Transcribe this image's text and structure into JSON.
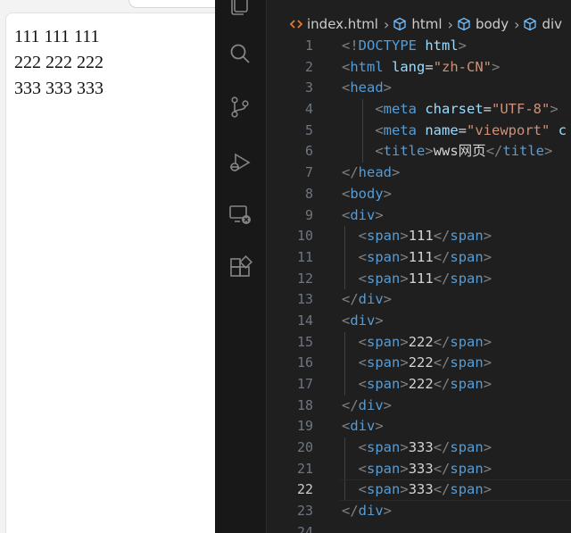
{
  "preview": {
    "rows": [
      [
        "111",
        "111",
        "111"
      ],
      [
        "222",
        "222",
        "222"
      ],
      [
        "333",
        "333",
        "333"
      ]
    ]
  },
  "editor": {
    "activity_icons": [
      "explorer-icon",
      "search-icon",
      "source-control-icon",
      "run-debug-icon",
      "remote-explorer-icon",
      "extensions-icon"
    ],
    "breadcrumb": {
      "file": "index.html",
      "items": [
        "html",
        "body",
        "div"
      ]
    },
    "active_line": 22,
    "line_numbers": [
      "1",
      "2",
      "3",
      "4",
      "5",
      "6",
      "7",
      "8",
      "9",
      "10",
      "11",
      "12",
      "13",
      "14",
      "15",
      "16",
      "17",
      "18",
      "19",
      "20",
      "21",
      "22",
      "23",
      "24"
    ],
    "lines": [
      [
        [
          "punct",
          "<!"
        ],
        [
          "tag",
          "DOCTYPE"
        ],
        [
          "text",
          " "
        ],
        [
          "attr",
          "html"
        ],
        [
          "punct",
          ">"
        ]
      ],
      [
        [
          "punct",
          "<"
        ],
        [
          "tag",
          "html"
        ],
        [
          "text",
          " "
        ],
        [
          "attr",
          "lang"
        ],
        [
          "text",
          "="
        ],
        [
          "str",
          "\"zh-CN\""
        ],
        [
          "punct",
          ">"
        ]
      ],
      [
        [
          "punct",
          "<"
        ],
        [
          "tag",
          "head"
        ],
        [
          "punct",
          ">"
        ]
      ],
      [
        [
          "text",
          "    "
        ],
        [
          "punct",
          "<"
        ],
        [
          "tag",
          "meta"
        ],
        [
          "text",
          " "
        ],
        [
          "attr",
          "charset"
        ],
        [
          "text",
          "="
        ],
        [
          "str",
          "\"UTF-8\""
        ],
        [
          "punct",
          ">"
        ]
      ],
      [
        [
          "text",
          "    "
        ],
        [
          "punct",
          "<"
        ],
        [
          "tag",
          "meta"
        ],
        [
          "text",
          " "
        ],
        [
          "attr",
          "name"
        ],
        [
          "text",
          "="
        ],
        [
          "str",
          "\"viewport\""
        ],
        [
          "text",
          " "
        ],
        [
          "attr",
          "c"
        ]
      ],
      [
        [
          "text",
          "    "
        ],
        [
          "punct",
          "<"
        ],
        [
          "tag",
          "title"
        ],
        [
          "punct",
          ">"
        ],
        [
          "text",
          "wws网页"
        ],
        [
          "punct",
          "</"
        ],
        [
          "tag",
          "title"
        ],
        [
          "punct",
          ">"
        ]
      ],
      [
        [
          "punct",
          "</"
        ],
        [
          "tag",
          "head"
        ],
        [
          "punct",
          ">"
        ]
      ],
      [
        [
          "punct",
          "<"
        ],
        [
          "tag",
          "body"
        ],
        [
          "punct",
          ">"
        ]
      ],
      [
        [
          "punct",
          "<"
        ],
        [
          "tag",
          "div"
        ],
        [
          "punct",
          ">"
        ]
      ],
      [
        [
          "text",
          "  "
        ],
        [
          "punct",
          "<"
        ],
        [
          "tag",
          "span"
        ],
        [
          "punct",
          ">"
        ],
        [
          "text",
          "111"
        ],
        [
          "punct",
          "</"
        ],
        [
          "tag",
          "span"
        ],
        [
          "punct",
          ">"
        ]
      ],
      [
        [
          "text",
          "  "
        ],
        [
          "punct",
          "<"
        ],
        [
          "tag",
          "span"
        ],
        [
          "punct",
          ">"
        ],
        [
          "text",
          "111"
        ],
        [
          "punct",
          "</"
        ],
        [
          "tag",
          "span"
        ],
        [
          "punct",
          ">"
        ]
      ],
      [
        [
          "text",
          "  "
        ],
        [
          "punct",
          "<"
        ],
        [
          "tag",
          "span"
        ],
        [
          "punct",
          ">"
        ],
        [
          "text",
          "111"
        ],
        [
          "punct",
          "</"
        ],
        [
          "tag",
          "span"
        ],
        [
          "punct",
          ">"
        ]
      ],
      [
        [
          "punct",
          "</"
        ],
        [
          "tag",
          "div"
        ],
        [
          "punct",
          ">"
        ]
      ],
      [
        [
          "punct",
          "<"
        ],
        [
          "tag",
          "div"
        ],
        [
          "punct",
          ">"
        ]
      ],
      [
        [
          "text",
          "  "
        ],
        [
          "punct",
          "<"
        ],
        [
          "tag",
          "span"
        ],
        [
          "punct",
          ">"
        ],
        [
          "text",
          "222"
        ],
        [
          "punct",
          "</"
        ],
        [
          "tag",
          "span"
        ],
        [
          "punct",
          ">"
        ]
      ],
      [
        [
          "text",
          "  "
        ],
        [
          "punct",
          "<"
        ],
        [
          "tag",
          "span"
        ],
        [
          "punct",
          ">"
        ],
        [
          "text",
          "222"
        ],
        [
          "punct",
          "</"
        ],
        [
          "tag",
          "span"
        ],
        [
          "punct",
          ">"
        ]
      ],
      [
        [
          "text",
          "  "
        ],
        [
          "punct",
          "<"
        ],
        [
          "tag",
          "span"
        ],
        [
          "punct",
          ">"
        ],
        [
          "text",
          "222"
        ],
        [
          "punct",
          "</"
        ],
        [
          "tag",
          "span"
        ],
        [
          "punct",
          ">"
        ]
      ],
      [
        [
          "punct",
          "</"
        ],
        [
          "tag",
          "div"
        ],
        [
          "punct",
          ">"
        ]
      ],
      [
        [
          "punct",
          "<"
        ],
        [
          "tag",
          "div"
        ],
        [
          "punct",
          ">"
        ]
      ],
      [
        [
          "text",
          "  "
        ],
        [
          "punct",
          "<"
        ],
        [
          "tag",
          "span"
        ],
        [
          "punct",
          ">"
        ],
        [
          "text",
          "333"
        ],
        [
          "punct",
          "</"
        ],
        [
          "tag",
          "span"
        ],
        [
          "punct",
          ">"
        ]
      ],
      [
        [
          "text",
          "  "
        ],
        [
          "punct",
          "<"
        ],
        [
          "tag",
          "span"
        ],
        [
          "punct",
          ">"
        ],
        [
          "text",
          "333"
        ],
        [
          "punct",
          "</"
        ],
        [
          "tag",
          "span"
        ],
        [
          "punct",
          ">"
        ]
      ],
      [
        [
          "text",
          "  "
        ],
        [
          "punct",
          "<"
        ],
        [
          "tag",
          "span"
        ],
        [
          "punct",
          ">"
        ],
        [
          "text",
          "333"
        ],
        [
          "punct",
          "</"
        ],
        [
          "tag",
          "span"
        ],
        [
          "punct",
          ">"
        ]
      ],
      [
        [
          "punct",
          "</"
        ],
        [
          "tag",
          "div"
        ],
        [
          "punct",
          ">"
        ]
      ],
      []
    ]
  },
  "colors": {
    "editor_bg": "#1f1f1f",
    "tag": "#569cd6",
    "attribute": "#9cdcfe",
    "string": "#ce9178",
    "breadcrumb_file_icon": "#e37933",
    "breadcrumb_symbol_icon": "#75beff"
  }
}
